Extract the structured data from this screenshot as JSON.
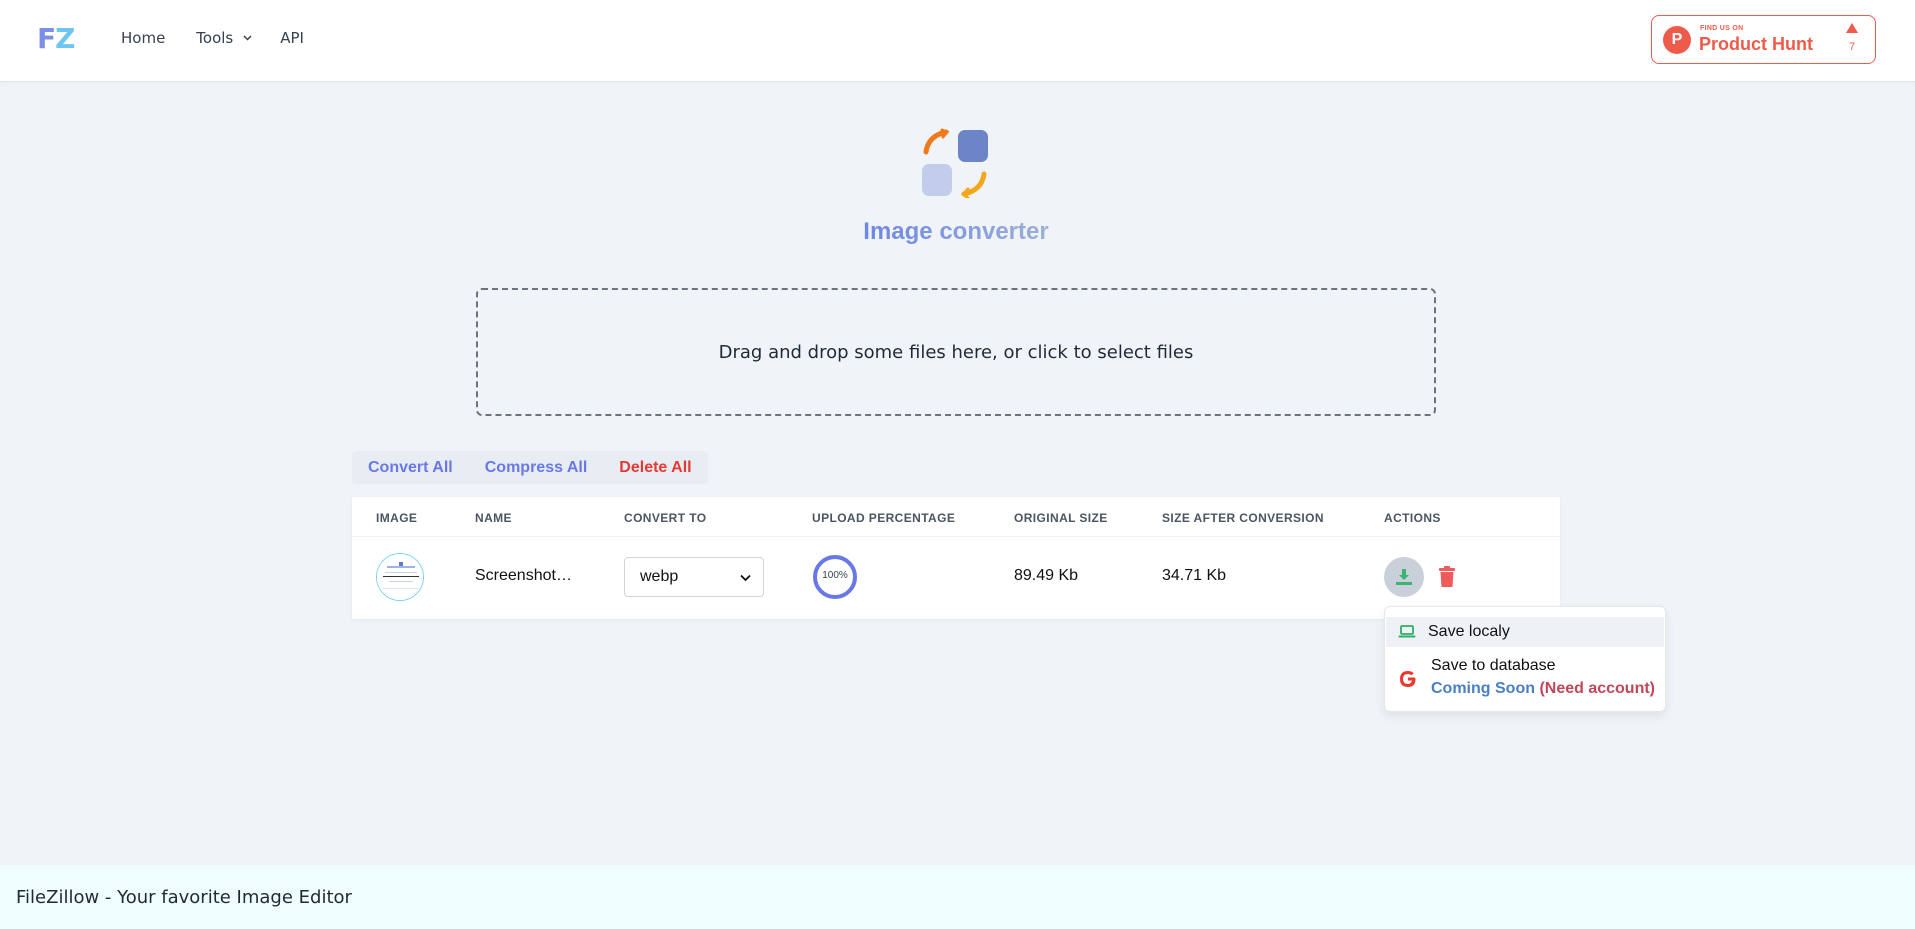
{
  "header": {
    "logo_f": "F",
    "logo_z": "Z",
    "nav": {
      "home": "Home",
      "tools": "Tools",
      "api": "API"
    },
    "product_hunt": {
      "small": "FIND US ON",
      "big": "Product Hunt",
      "count": "7"
    }
  },
  "hero": {
    "title": "Image converter"
  },
  "dropzone": {
    "text": "Drag and drop some files here, or click to select files"
  },
  "bulk_actions": {
    "convert_all": "Convert All",
    "compress_all": "Compress All",
    "delete_all": "Delete All"
  },
  "table": {
    "columns": {
      "image": "IMAGE",
      "name": "NAME",
      "convert_to": "CONVERT TO",
      "upload_percentage": "UPLOAD PERCENTAGE",
      "original_size": "ORIGINAL SIZE",
      "size_after": "SIZE AFTER CONVERSION",
      "actions": "ACTIONS"
    },
    "rows": [
      {
        "name": "Screenshot…",
        "format": "webp",
        "progress": 1.0,
        "progress_label": "100%",
        "original_size": "89.49 Kb",
        "converted_size": "34.71 Kb"
      }
    ]
  },
  "download_menu": {
    "save_local": "Save localy",
    "save_db": "Save to database",
    "coming_soon": "Coming Soon",
    "need_account": "(Need account)"
  },
  "footer": {
    "text": "FileZillow - Your favorite Image Editor"
  },
  "colors": {
    "accent": "#6878e8",
    "danger": "#e53935",
    "product_hunt": "#ef5b4b",
    "progress": "#6878e8"
  },
  "icons": {
    "logo": "fz-logo",
    "hero": "image-converter-icon",
    "download": "download-icon",
    "trash": "trash-icon",
    "laptop": "laptop-icon",
    "google": "google-icon",
    "chevron": "chevron-down-icon",
    "upvote": "upvote-triangle-icon"
  }
}
